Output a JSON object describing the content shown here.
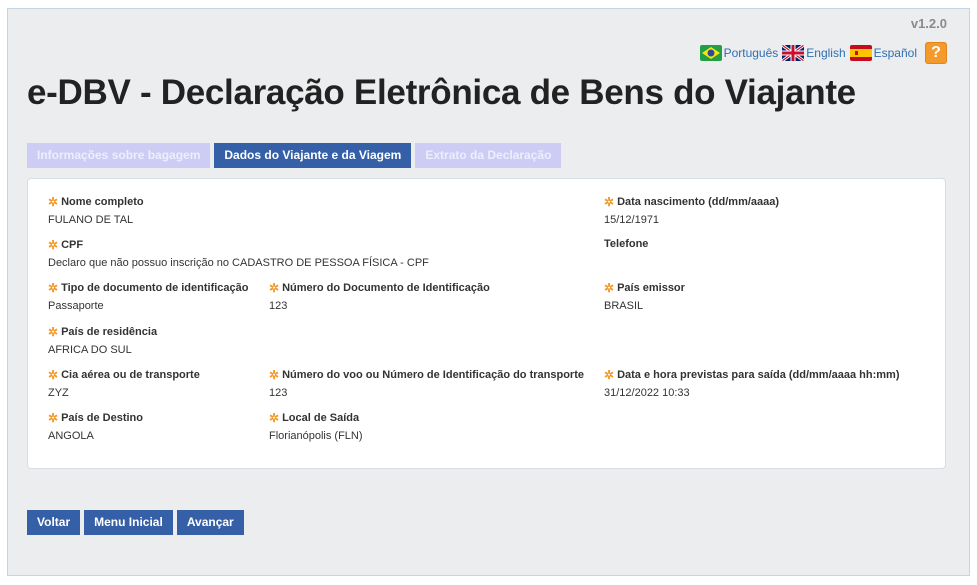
{
  "header": {
    "version": "v1.2.0",
    "title": "e-DBV - Declaração Eletrônica de Bens do Viajante",
    "languages": [
      {
        "label": "Português",
        "icon": "brazil-flag-icon"
      },
      {
        "label": "English",
        "icon": "uk-flag-icon"
      },
      {
        "label": "Español",
        "icon": "spain-flag-icon"
      }
    ],
    "help_symbol": "?"
  },
  "tabs": [
    {
      "label": "Informações sobre bagagem",
      "active": false
    },
    {
      "label": "Dados do Viajante e da Viagem",
      "active": true
    },
    {
      "label": "Extrato da Declaração",
      "active": false
    }
  ],
  "fields": {
    "nome": {
      "label": "Nome completo",
      "value": "FULANO DE TAL"
    },
    "nascimento": {
      "label": "Data nascimento (dd/mm/aaaa)",
      "value": "15/12/1971"
    },
    "cpf": {
      "label": "CPF",
      "value": "Declaro que não possuo inscrição no CADASTRO DE PESSOA FÍSICA - CPF"
    },
    "telefone": {
      "label": "Telefone",
      "value": ""
    },
    "tipo_doc": {
      "label": "Tipo de documento de identificação",
      "value": "Passaporte"
    },
    "num_doc": {
      "label": "Número do Documento de Identificação",
      "value": "123"
    },
    "pais_emissor": {
      "label": "País emissor",
      "value": "BRASIL"
    },
    "pais_residencia": {
      "label": "País de residência",
      "value": "AFRICA DO SUL"
    },
    "cia": {
      "label": "Cia aérea ou de transporte",
      "value": "ZYZ"
    },
    "num_voo": {
      "label": "Número do voo ou Número de Identificação do transporte",
      "value": "123"
    },
    "data_saida": {
      "label": "Data e hora previstas para saída (dd/mm/aaaa hh:mm)",
      "value": "31/12/2022 10:33"
    },
    "pais_destino": {
      "label": "País de Destino",
      "value": "ANGOLA"
    },
    "local_saida": {
      "label": "Local de Saída",
      "value": "Florianópolis (FLN)"
    }
  },
  "required_marker": "✲",
  "buttons": {
    "voltar": "Voltar",
    "menu": "Menu Inicial",
    "avancar": "Avançar"
  },
  "colors": {
    "primary": "#3560a8",
    "inactive_tab": "#ccccf5",
    "required_star": "#f49a2a"
  }
}
